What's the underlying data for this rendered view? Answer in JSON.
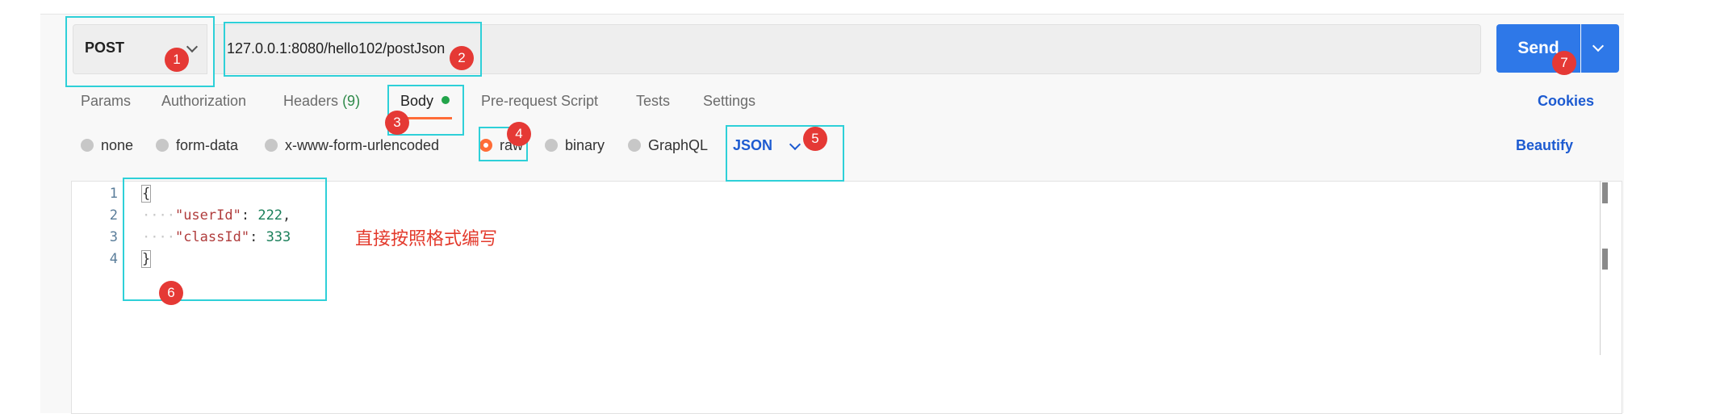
{
  "request": {
    "method": "POST",
    "url": "127.0.0.1:8080/hello102/postJson",
    "send_label": "Send"
  },
  "tabs": [
    {
      "label": "Params"
    },
    {
      "label": "Authorization"
    },
    {
      "label": "Headers",
      "count": "(9)"
    },
    {
      "label": "Body",
      "active": true
    },
    {
      "label": "Pre-request Script"
    },
    {
      "label": "Tests"
    },
    {
      "label": "Settings"
    }
  ],
  "cookies_label": "Cookies",
  "body_types": [
    {
      "label": "none"
    },
    {
      "label": "form-data"
    },
    {
      "label": "x-www-form-urlencoded"
    },
    {
      "label": "raw",
      "selected": true
    },
    {
      "label": "binary"
    },
    {
      "label": "GraphQL"
    }
  ],
  "format": "JSON",
  "beautify_label": "Beautify",
  "editor": {
    "line_numbers": [
      "1",
      "2",
      "3",
      "4"
    ],
    "lines": [
      {
        "open": "{"
      },
      {
        "ws": "····",
        "key": "\"userId\"",
        "sep": ": ",
        "value": "222",
        "end": ","
      },
      {
        "ws": "····",
        "key": "\"classId\"",
        "sep": ": ",
        "value": "333",
        "end": ""
      },
      {
        "close": "}"
      }
    ]
  },
  "annotation_note": "直接按照格式编写",
  "badges": [
    "1",
    "2",
    "3",
    "4",
    "5",
    "6",
    "7"
  ],
  "colors": {
    "send_button": "#2e78e8",
    "active_tab_underline": "#ff6c37",
    "annotation_box": "#2ed0d8",
    "annotation_badge": "#e53935",
    "link_blue": "#1d5bd1"
  }
}
